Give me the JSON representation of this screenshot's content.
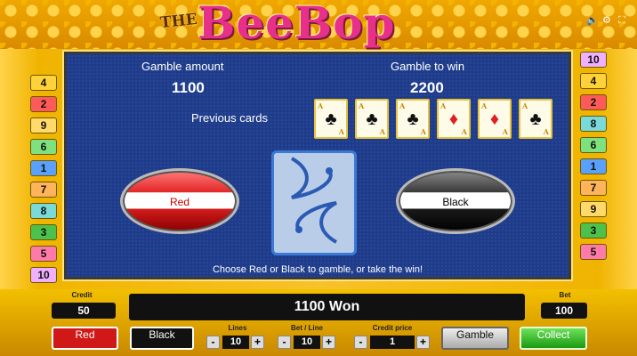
{
  "title": {
    "the": "THE",
    "main": "BeeBop"
  },
  "left_numbers": [
    "4",
    "2",
    "9",
    "6",
    "1",
    "7",
    "8",
    "3",
    "5",
    "10"
  ],
  "right_numbers": [
    "10",
    "4",
    "2",
    "8",
    "6",
    "1",
    "7",
    "9",
    "3",
    "5"
  ],
  "number_colors": {
    "1": "#5aa0ff",
    "2": "#ff5a5a",
    "3": "#4cc24c",
    "4": "#ffd23a",
    "5": "#ff7aa8",
    "6": "#7fe07f",
    "7": "#ffb35a",
    "8": "#7ad9d9",
    "9": "#ffd96a",
    "10": "#f0b0ff"
  },
  "gamble": {
    "amount_label": "Gamble amount",
    "amount_value": "1100",
    "to_win_label": "Gamble to win",
    "to_win_value": "2200",
    "previous_label": "Previous cards",
    "cards": [
      "♣",
      "♣",
      "♣",
      "♦",
      "♦",
      "♣"
    ],
    "card_letter": "A",
    "red_label": "Red",
    "black_label": "Black",
    "message": "Choose Red or Black to gamble, or take the win!"
  },
  "footer": {
    "credit_label": "Credit",
    "credit_value": "50",
    "won_text": "1100 Won",
    "bet_label": "Bet",
    "bet_value": "100",
    "lines_label": "Lines",
    "lines_value": "10",
    "betline_label": "Bet / Line",
    "betline_value": "10",
    "creditprice_label": "Credit price",
    "creditprice_value": "1",
    "red_button": "Red",
    "black_button": "Black",
    "gamble_button": "Gamble",
    "collect_button": "Collect",
    "minus": "-",
    "plus": "+"
  }
}
